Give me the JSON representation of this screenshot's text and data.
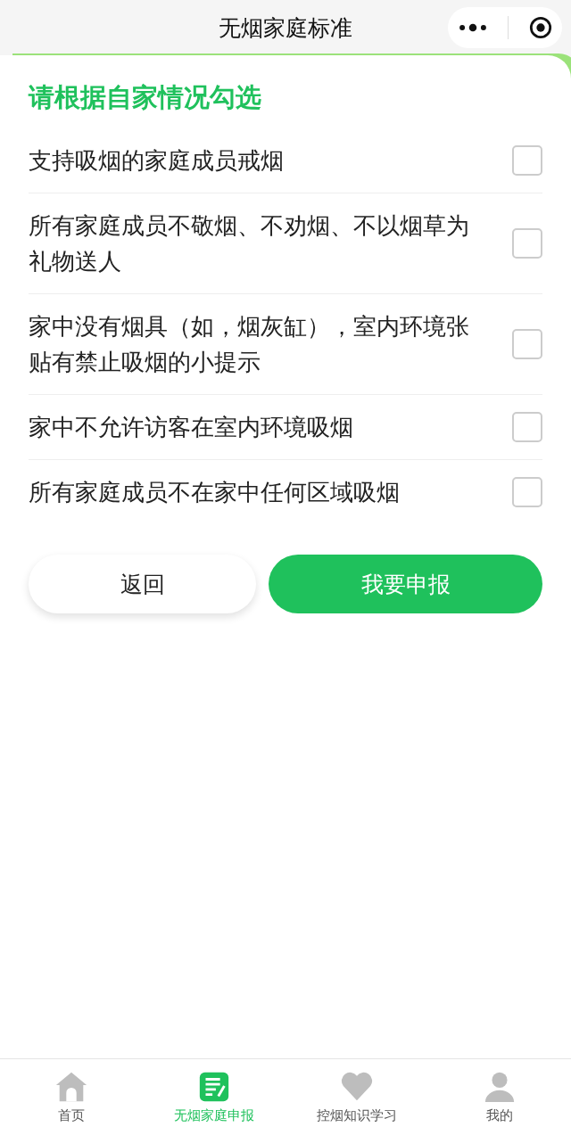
{
  "window": {
    "title": "无烟家庭标准"
  },
  "form": {
    "heading": "请根据自家情况勾选",
    "items": [
      {
        "label": "支持吸烟的家庭成员戒烟",
        "checked": false
      },
      {
        "label": "所有家庭成员不敬烟、不劝烟、不以烟草为礼物送人",
        "checked": false
      },
      {
        "label": "家中没有烟具（如，烟灰缸），室内环境张贴有禁止吸烟的小提示",
        "checked": false
      },
      {
        "label": "家中不允许访客在室内环境吸烟",
        "checked": false
      },
      {
        "label": "所有家庭成员不在家中任何区域吸烟",
        "checked": false
      }
    ]
  },
  "buttons": [
    {
      "label": "返回",
      "kind": "secondary"
    },
    {
      "label": "我要申报",
      "kind": "primary"
    }
  ],
  "tab_bar": [
    {
      "label": "首页",
      "kind": "home",
      "selected": false
    },
    {
      "label": "无烟家庭申报",
      "kind": "form",
      "selected": true
    },
    {
      "label": "控烟知识学习",
      "kind": "heart",
      "selected": false
    },
    {
      "label": "我的",
      "kind": "user",
      "selected": false
    }
  ]
}
